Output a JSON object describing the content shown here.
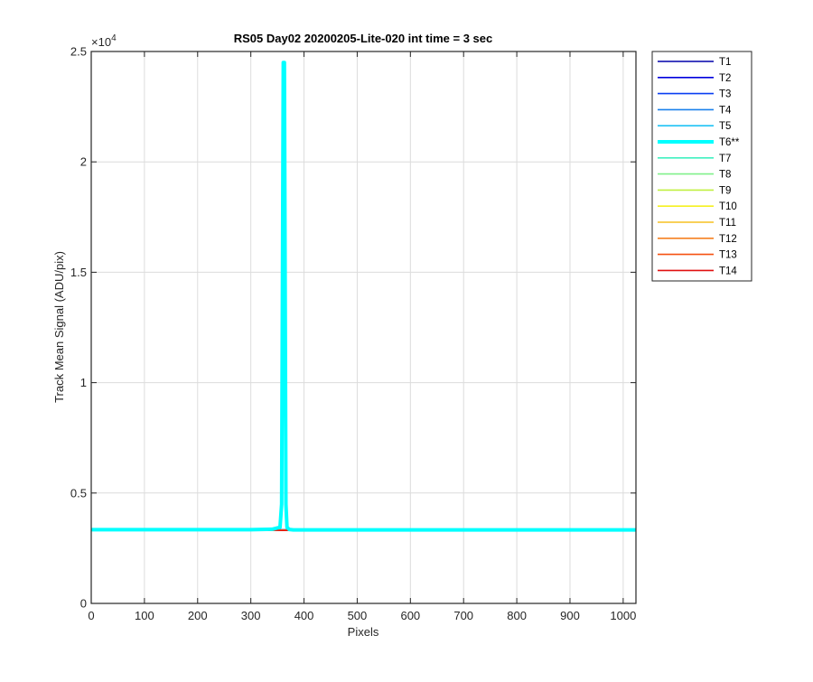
{
  "chart_data": {
    "type": "line",
    "title": "RS05 Day02 20200205-Lite-020 int time = 3 sec",
    "xlabel": "Pixels",
    "ylabel": "Track Mean Signal (ADU/pix)",
    "xlim": [
      0,
      1024
    ],
    "ylim": [
      0,
      25000
    ],
    "x_ticks": [
      0,
      100,
      200,
      300,
      400,
      500,
      600,
      700,
      800,
      900,
      1000
    ],
    "x_tick_labels": [
      "0",
      "100",
      "200",
      "300",
      "400",
      "500",
      "600",
      "700",
      "800",
      "900",
      "1000"
    ],
    "y_ticks": [
      0,
      5000,
      10000,
      15000,
      20000,
      25000
    ],
    "y_tick_labels": [
      "0",
      "0.5",
      "1",
      "1.5",
      "2",
      "2.5"
    ],
    "y_exponent_label": "×10",
    "y_exponent_power": "4",
    "grid": true,
    "legend_position": "outside-right",
    "series": [
      {
        "name": "T1",
        "color": "#0000aa",
        "values": [
          [
            0,
            3330
          ],
          [
            1024,
            3330
          ]
        ]
      },
      {
        "name": "T2",
        "color": "#0000dd",
        "values": [
          [
            0,
            3330
          ],
          [
            1024,
            3330
          ]
        ]
      },
      {
        "name": "T3",
        "color": "#0a3ff2",
        "values": [
          [
            0,
            3330
          ],
          [
            1024,
            3330
          ]
        ]
      },
      {
        "name": "T4",
        "color": "#1a80ec",
        "values": [
          [
            0,
            3330
          ],
          [
            1024,
            3330
          ]
        ]
      },
      {
        "name": "T5",
        "color": "#1fc2f5",
        "values": [
          [
            0,
            3330
          ],
          [
            1024,
            3330
          ]
        ]
      },
      {
        "name": "T6**",
        "color": "#00ffff",
        "highlight": true,
        "values": [
          [
            0,
            3340
          ],
          [
            300,
            3340
          ],
          [
            340,
            3360
          ],
          [
            355,
            3450
          ],
          [
            358,
            4500
          ],
          [
            361,
            24500
          ],
          [
            363,
            24500
          ],
          [
            366,
            4500
          ],
          [
            368,
            3450
          ],
          [
            372,
            3350
          ],
          [
            380,
            3330
          ],
          [
            1024,
            3330
          ]
        ]
      },
      {
        "name": "T7",
        "color": "#40f0c0",
        "values": [
          [
            0,
            3320
          ],
          [
            1024,
            3320
          ]
        ]
      },
      {
        "name": "T8",
        "color": "#80f08a",
        "values": [
          [
            0,
            3320
          ],
          [
            1024,
            3320
          ]
        ]
      },
      {
        "name": "T9",
        "color": "#c0f040",
        "values": [
          [
            0,
            3320
          ],
          [
            1024,
            3320
          ]
        ]
      },
      {
        "name": "T10",
        "color": "#f5f020",
        "values": [
          [
            0,
            3320
          ],
          [
            1024,
            3320
          ]
        ]
      },
      {
        "name": "T11",
        "color": "#f5c020",
        "values": [
          [
            0,
            3320
          ],
          [
            1024,
            3320
          ]
        ]
      },
      {
        "name": "T12",
        "color": "#f58020",
        "values": [
          [
            0,
            3320
          ],
          [
            1024,
            3320
          ]
        ]
      },
      {
        "name": "T13",
        "color": "#f55010",
        "values": [
          [
            0,
            3320
          ],
          [
            1024,
            3320
          ]
        ]
      },
      {
        "name": "T14",
        "color": "#e01010",
        "values": [
          [
            0,
            3310
          ],
          [
            340,
            3310
          ],
          [
            360,
            3300
          ],
          [
            380,
            3310
          ],
          [
            1024,
            3310
          ]
        ]
      }
    ]
  }
}
